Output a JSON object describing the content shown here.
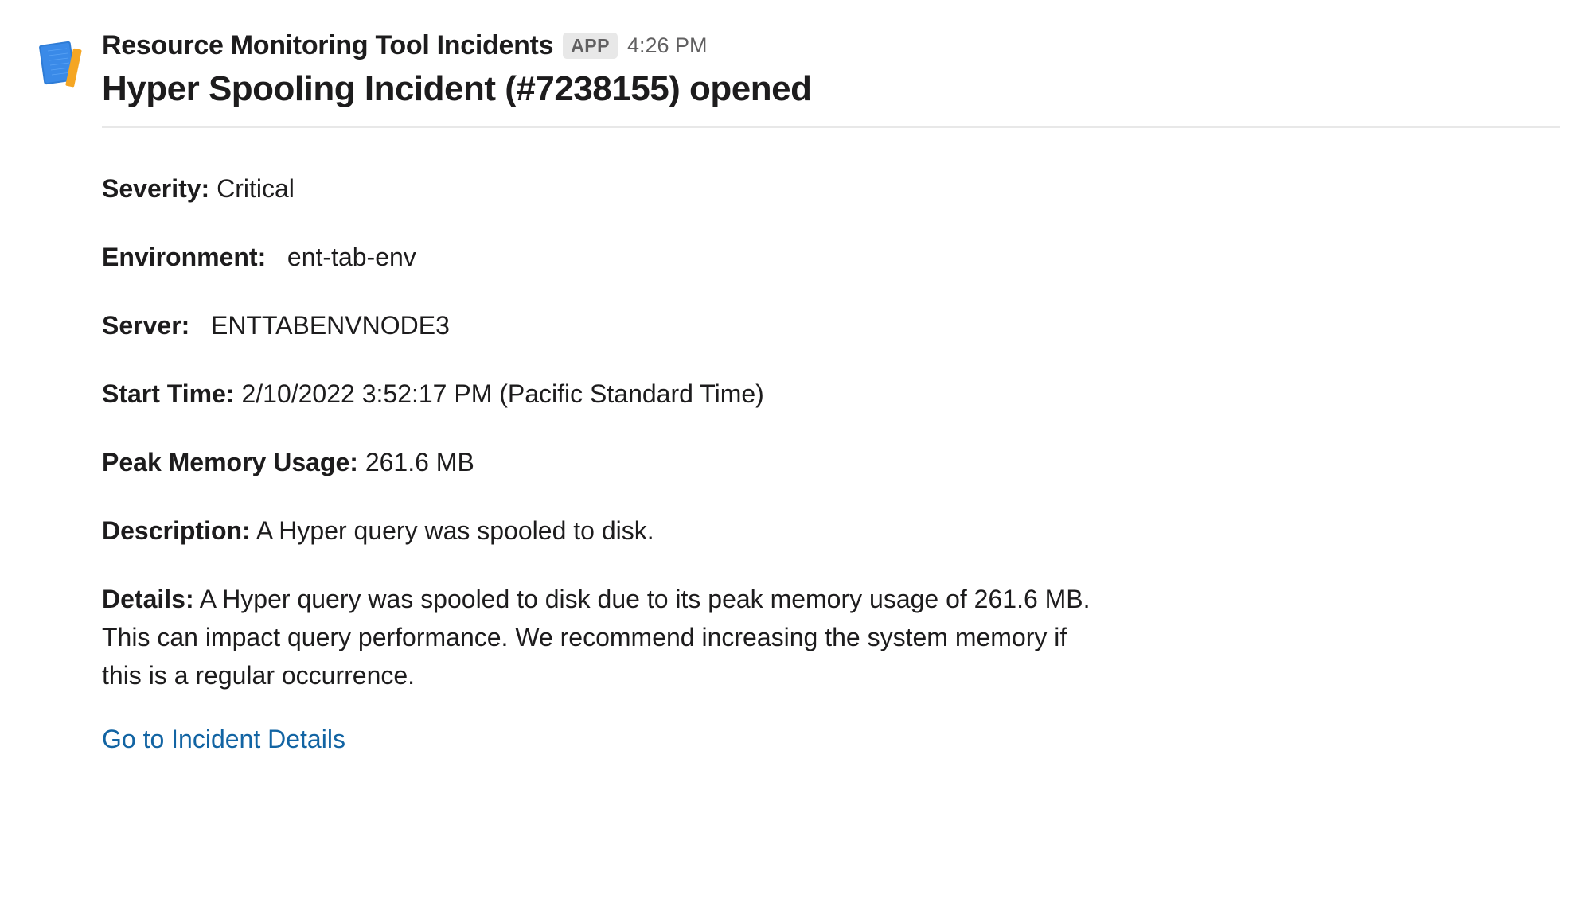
{
  "header": {
    "app_name": "Resource Monitoring Tool Incidents",
    "badge": "APP",
    "timestamp": "4:26 PM"
  },
  "incident": {
    "title": "Hyper Spooling Incident (#7238155) opened"
  },
  "fields": {
    "severity": {
      "label": "Severity:",
      "value": "Critical"
    },
    "environment": {
      "label": "Environment:",
      "value": "ent-tab-env"
    },
    "server": {
      "label": "Server:",
      "value": "ENTTABENVNODE3"
    },
    "start_time": {
      "label": "Start Time:",
      "value": "2/10/2022 3:52:17 PM (Pacific Standard Time)"
    },
    "peak_memory": {
      "label": "Peak Memory Usage:",
      "value": "261.6 MB"
    },
    "description": {
      "label": "Description:",
      "value": "A Hyper query was spooled to disk."
    },
    "details": {
      "label": "Details:",
      "value": "A Hyper query was spooled to disk due to its peak memory usage of 261.6 MB. This can impact query performance. We recommend increasing the system memory if this is a regular occurrence."
    }
  },
  "link": {
    "label": "Go to Incident Details"
  }
}
